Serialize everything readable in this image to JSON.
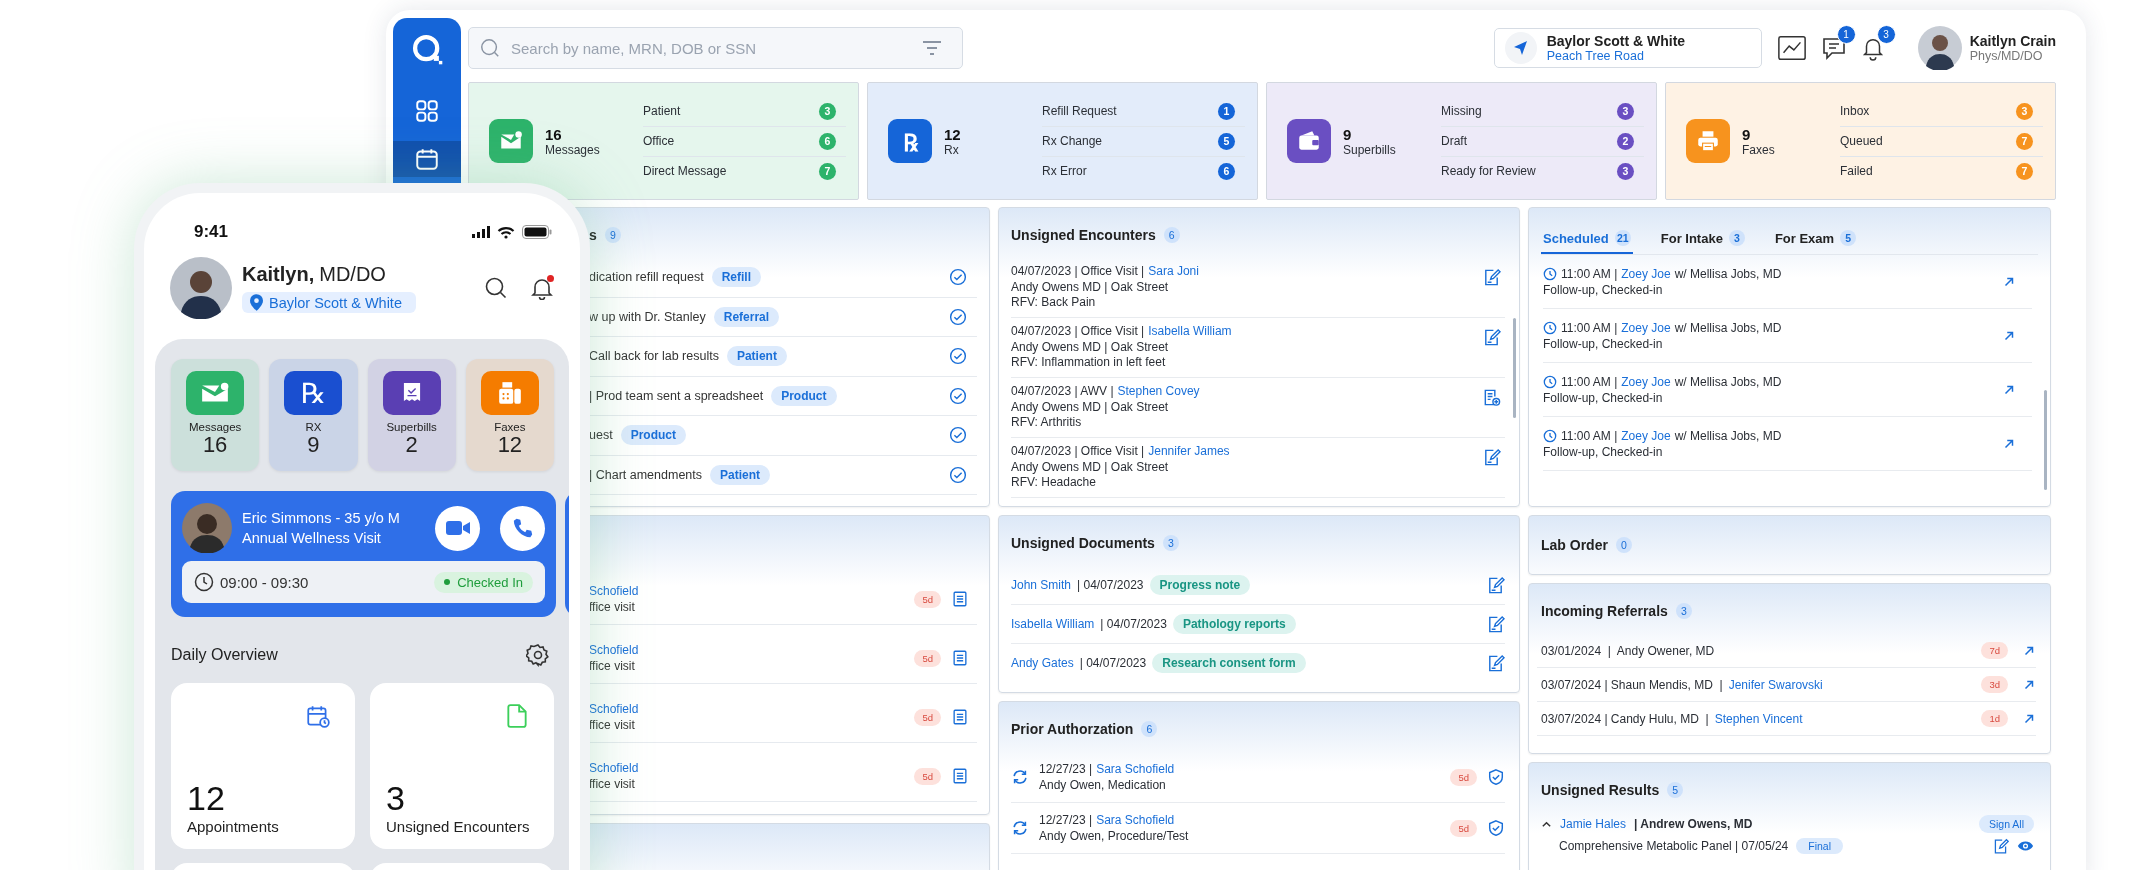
{
  "sidebar": {
    "items": [
      {
        "kind": "grid",
        "selected": false
      },
      {
        "kind": "calendar",
        "selected": true
      }
    ]
  },
  "search": {
    "placeholder": "Search by name, MRN, DOB or SSN"
  },
  "location": {
    "name": "Baylor Scott & White",
    "branch": "Peach Tree Road"
  },
  "header_badges": {
    "messages": "1",
    "notifications": "3"
  },
  "user": {
    "name": "Kaitlyn Crain",
    "role": "Phys/MD/DO"
  },
  "summary": [
    {
      "kind": "messages",
      "count": "16",
      "label": "Messages",
      "color": "#2db36b",
      "items": [
        {
          "label": "Patient",
          "count": "3"
        },
        {
          "label": "Office",
          "count": "6"
        },
        {
          "label": "Direct Message",
          "count": "7"
        }
      ]
    },
    {
      "kind": "rx",
      "glyph": "℞",
      "count": "12",
      "label": "Rx",
      "color": "#1565d8",
      "items": [
        {
          "label": "Refill Request",
          "count": "1"
        },
        {
          "label": "Rx Change",
          "count": "5"
        },
        {
          "label": "Rx Error",
          "count": "6"
        }
      ]
    },
    {
      "kind": "superbills",
      "count": "9",
      "label": "Superbills",
      "color": "#6a4fc2",
      "items": [
        {
          "label": "Missing",
          "count": "3"
        },
        {
          "label": "Draft",
          "count": "2"
        },
        {
          "label": "Ready for Review",
          "count": "3"
        }
      ]
    },
    {
      "kind": "faxes",
      "count": "9",
      "label": "Faxes",
      "color": "#f7931e",
      "items": [
        {
          "label": "Inbox",
          "count": "3"
        },
        {
          "label": "Queued",
          "count": "7"
        },
        {
          "label": "Failed",
          "count": "7"
        }
      ]
    }
  ],
  "tasks": {
    "title": "s",
    "count": "9",
    "rows": [
      {
        "text": "dication refill request",
        "tag": "Refill"
      },
      {
        "text": "w up with Dr. Stanley",
        "tag": "Referral"
      },
      {
        "text": "Call back for lab results",
        "tag": "Patient"
      },
      {
        "text": "| Prod team sent a spreadsheet",
        "tag": "Product"
      },
      {
        "text": "uest",
        "tag": "Product"
      },
      {
        "text": "| Chart amendments",
        "tag": "Patient"
      }
    ]
  },
  "pending": {
    "rows": [
      {
        "name": "Schofield",
        "detail": "ffice visit",
        "age": "5d"
      },
      {
        "name": "Schofield",
        "detail": "ffice visit",
        "age": "5d"
      },
      {
        "name": "Schofield",
        "detail": "ffice visit",
        "age": "5d"
      },
      {
        "name": "Schofield",
        "detail": "ffice visit",
        "age": "5d"
      }
    ]
  },
  "unsigned_encounters": {
    "title": "Unsigned Encounters",
    "count": "6",
    "rows": [
      {
        "meta": "04/07/2023 | Office Visit |",
        "patient": "Sara Joni",
        "provider": "Andy Owens MD | Oak Street",
        "rfv": "RFV: Back Pain",
        "kind": "sign"
      },
      {
        "meta": "04/07/2023 | Office Visit |",
        "patient": "Isabella William",
        "provider": "Andy Owens MD | Oak Street",
        "rfv": "RFV: Inflammation in left feet",
        "kind": "sign"
      },
      {
        "meta": "04/07/2023 | AWV |",
        "patient": "Stephen Covey",
        "provider": "Andy Owens MD | Oak Street",
        "rfv": "RFV: Arthritis",
        "kind": "add"
      },
      {
        "meta": "04/07/2023 | Office Visit |",
        "patient": "Jennifer James",
        "provider": "Andy Owens MD | Oak Street",
        "rfv": "RFV: Headache",
        "kind": "sign"
      }
    ]
  },
  "unsigned_documents": {
    "title": "Unsigned Documents",
    "count": "3",
    "rows": [
      {
        "patient": "John Smith",
        "date": "| 04/07/2023",
        "tag": "Progress note"
      },
      {
        "patient": "Isabella William",
        "date": "| 04/07/2023",
        "tag": "Pathology reports"
      },
      {
        "patient": "Andy Gates",
        "date": "| 04/07/2023",
        "tag": "Research consent form"
      }
    ]
  },
  "prior_authorization": {
    "title": "Prior Authorzation",
    "count": "6",
    "rows": [
      {
        "date": "12/27/23 |",
        "patient": "Sara Schofield",
        "detail": "Andy Owen, Medication",
        "age": "5d"
      },
      {
        "date": "12/27/23 |",
        "patient": "Sara Schofield",
        "detail": "Andy Owen, Procedure/Test",
        "age": "5d"
      }
    ]
  },
  "schedule": {
    "tabs": [
      {
        "label": "Scheduled",
        "count": "21",
        "selected": true
      },
      {
        "label": "For Intake",
        "count": "3",
        "selected": false
      },
      {
        "label": "For Exam",
        "count": "5",
        "selected": false
      }
    ],
    "rows": [
      {
        "time": "11:00 AM |",
        "patient": "Zoey Joe",
        "provider": "w/ Mellisa Jobs, MD",
        "status": "Follow-up, Checked-in"
      },
      {
        "time": "11:00 AM |",
        "patient": "Zoey Joe",
        "provider": "w/ Mellisa Jobs, MD",
        "status": "Follow-up, Checked-in"
      },
      {
        "time": "11:00 AM |",
        "patient": "Zoey Joe",
        "provider": "w/ Mellisa Jobs, MD",
        "status": "Follow-up, Checked-in"
      },
      {
        "time": "11:00 AM |",
        "patient": "Zoey Joe",
        "provider": "w/ Mellisa Jobs, MD",
        "status": "Follow-up, Checked-in"
      }
    ]
  },
  "lab_order": {
    "title": "Lab Order",
    "count": "0"
  },
  "incoming_referrals": {
    "title": "Incoming Referrals",
    "count": "3",
    "rows": [
      {
        "info": "03/01/2024  |  Andy Owener, MD",
        "age": "7d"
      },
      {
        "info": "03/07/2024 | Shaun Mendis, MD  |",
        "patient": "Jenifer Swarovski",
        "age": "3d"
      },
      {
        "info": "03/07/2024 | Candy Hulu, MD  |",
        "patient": "Stephen Vincent",
        "age": "1d"
      }
    ]
  },
  "unsigned_results": {
    "title": "Unsigned Results",
    "count": "5",
    "action": "Sign All",
    "rows": [
      {
        "patient": "Jamie Hales",
        "provider": "| Andrew Owens, MD",
        "test": "Comprehensive Metabolic Panel | 07/05/24",
        "status": "Final",
        "expanded": true
      }
    ]
  },
  "phone": {
    "time": "9:41",
    "name": "Kaitlyn,",
    "credentials": "MD/DO",
    "unread": true,
    "location": "Baylor Scott & White",
    "tiles": [
      {
        "kind": "messages",
        "label": "Messages",
        "count": "16",
        "color": "#2db36b"
      },
      {
        "kind": "rx",
        "glyph": "℞",
        "label": "RX",
        "count": "9",
        "color": "#1a4fd0"
      },
      {
        "kind": "superbills",
        "label": "Superbills",
        "count": "2",
        "color": "#5a3fb3"
      },
      {
        "kind": "faxes",
        "label": "Faxes",
        "count": "12",
        "color": "#f57c00"
      }
    ],
    "appointment": {
      "patient": "Eric Simmons - 35 y/o M",
      "visit": "Annual Wellness Visit",
      "time": "09:00 - 09:30",
      "status": "Checked In"
    },
    "overview": {
      "title": "Daily Overview",
      "cards": [
        {
          "kind": "calendar",
          "count": "12",
          "label": "Appointments"
        },
        {
          "kind": "document",
          "count": "3",
          "label": "Unsigned Encounters"
        }
      ]
    }
  }
}
